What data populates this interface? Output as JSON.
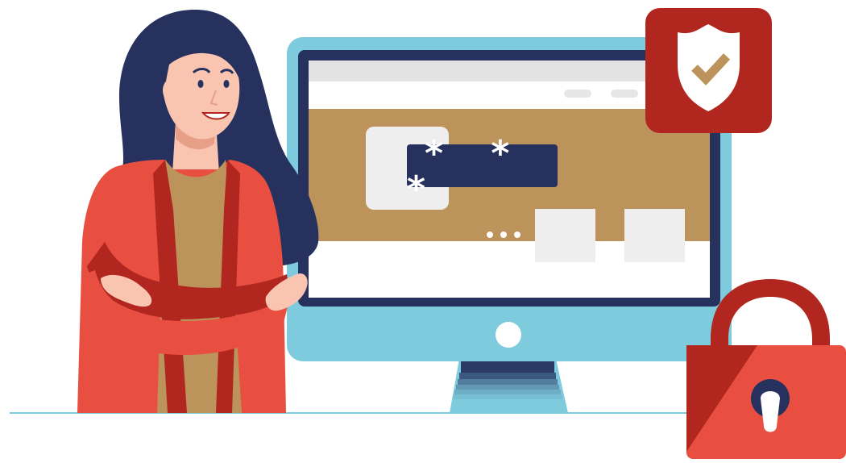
{
  "illustration": {
    "subject": "online security",
    "icons": [
      "shield-check-icon",
      "padlock-icon",
      "password-field"
    ]
  },
  "password_field": {
    "masked_value": "* * *"
  },
  "colors": {
    "navy": "#27315e",
    "light_blue": "#7ecbdd",
    "tan": "#bb935b",
    "red_dark": "#b1261f",
    "red": "#e84f41",
    "light_gray": "#eeeeee",
    "skin": "#f9c5b1"
  }
}
